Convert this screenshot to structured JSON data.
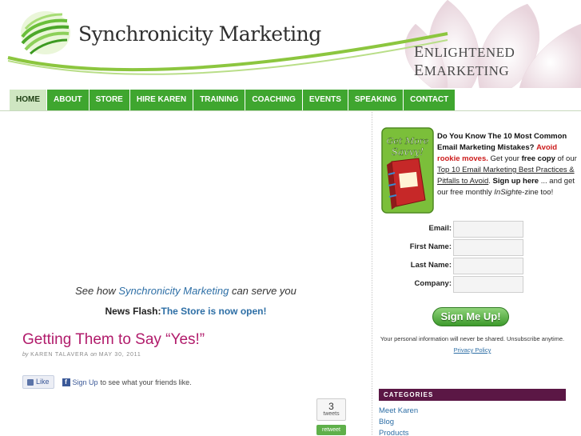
{
  "header": {
    "brand_name": "Synchronicity Marketing",
    "tagline_first": "E",
    "tagline_rest1": "NLIGHTENED ",
    "tagline_mid": "E",
    "tagline_rest2": "MARKETING"
  },
  "nav": {
    "items": [
      {
        "label": "HOME"
      },
      {
        "label": "ABOUT"
      },
      {
        "label": "STORE"
      },
      {
        "label": "HIRE KAREN"
      },
      {
        "label": "TRAINING"
      },
      {
        "label": "COACHING"
      },
      {
        "label": "EVENTS"
      },
      {
        "label": "SPEAKING"
      },
      {
        "label": "CONTACT"
      }
    ]
  },
  "main": {
    "serve_prefix": "See how ",
    "serve_brand": "Synchronicity Marketing",
    "serve_suffix": " can serve you",
    "newsflash_label": "News Flash:",
    "newsflash_link": "The Store is now open!",
    "post_title": "Getting Them to Say “Yes!”",
    "byline_by": "by",
    "byline_author": "KAREN TALAVERA",
    "byline_on": "on",
    "byline_date": "MAY 30, 2011",
    "fb_like": "Like",
    "fb_icon": "f",
    "fb_signup": "Sign Up",
    "fb_text": "to see what your friends like.",
    "tweet_count": "3",
    "tweet_label": "tweets",
    "retweet_label": "retweet"
  },
  "sidebar": {
    "promo": {
      "headline": "Do You Know The 10 Most Common Email Marketing Mistakes?",
      "avoid": "Avoid rookie moves.",
      "get_your": " Get your ",
      "free_copy": "free copy",
      "of_our": " of our ",
      "report_link": "Top 10 Email Marketing Best Practices & Pitfalls to Avoid",
      "period": ".",
      "sign_up": " Sign up here",
      "and_get": " ... and get our free monthly ",
      "insight": "InSight",
      "ezine": "e-zine too!"
    },
    "book_text": "Get More Savvy!",
    "form": {
      "email_label": "Email:",
      "first_label": "First Name:",
      "last_label": "Last Name:",
      "company_label": "Company:",
      "email_value": "",
      "first_value": "",
      "last_value": "",
      "company_value": ""
    },
    "signup_button": "Sign Me Up!",
    "privacy_text": "Your personal information will never be shared. Unsubscribe anytime.",
    "privacy_link": "Privacy Policy",
    "categories_title": "CATEGORIES",
    "categories": [
      {
        "label": "Meet Karen"
      },
      {
        "label": "Blog"
      },
      {
        "label": "Products"
      }
    ]
  },
  "colors": {
    "nav_green": "#3fa62f",
    "nav_active": "#cfe6c2",
    "link_blue": "#2e6fa6",
    "post_title": "#b11b6b",
    "category_header": "#5b1745"
  }
}
